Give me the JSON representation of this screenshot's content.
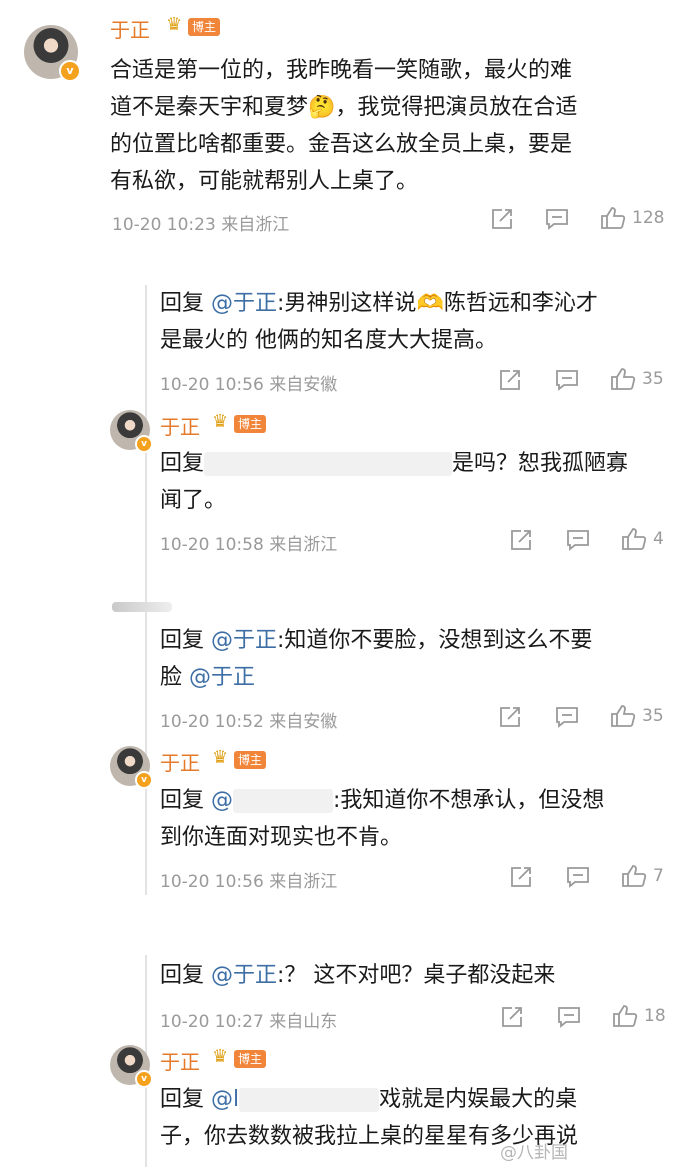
{
  "post": {
    "author": "于正",
    "badge": "博主",
    "lines": [
      "合适是第一位的，我昨晚看一笑随歌，最火的难",
      "道不是秦天宇和夏梦",
      "，我觉得把演员放在合适",
      "的位置比啥都重要。金吾这么放全员上桌，要是",
      "有私欲，可能就帮别人上桌了。"
    ],
    "emoji": "🤔",
    "time": "10-20 10:23",
    "location": "来自浙江",
    "likes": "128"
  },
  "replies": [
    {
      "prefix": "回复 ",
      "mention": "@于正",
      "line1": ":男神别这样说",
      "emoji": "🫶",
      "line1b": "陈哲远和李沁才",
      "line2": "是最火的 他俩的知名度大大提高。",
      "time": "10-20 10:56",
      "location": "来自安徽",
      "likes": "35"
    },
    {
      "author": "于正",
      "badge": "博主",
      "prefix": "回复",
      "line1": "是吗？恕我孤陋寡",
      "line2": "闻了。",
      "time": "10-20 10:58",
      "location": "来自浙江",
      "likes": "4"
    },
    {
      "prefix": "回复 ",
      "mention": "@于正",
      "line1": ":知道你不要脸，没想到这么不要",
      "line2a": "脸 ",
      "line2mention": "@于正",
      "time": "10-20 10:52",
      "location": "来自安徽",
      "likes": "35"
    },
    {
      "author": "于正",
      "badge": "博主",
      "prefix": "回复 ",
      "mention": "@",
      "line1": ":我知道你不想承认，但没想",
      "line2": "到你连面对现实也不肯。",
      "time": "10-20 10:56",
      "location": "来自浙江",
      "likes": "7"
    },
    {
      "prefix": "回复 ",
      "mention": "@于正",
      "line1": ":？ 这不对吧？桌子都没起来",
      "time": "10-20 10:27",
      "location": "来自山东",
      "likes": "18"
    },
    {
      "author": "于正",
      "badge": "博主",
      "prefix": "回复 ",
      "mention": "@l",
      "line1": "戏就是内娱最大的桌",
      "line2": "子，你去数数被我拉上桌的星星有多少再说"
    }
  ],
  "watermark": "@八卦国"
}
